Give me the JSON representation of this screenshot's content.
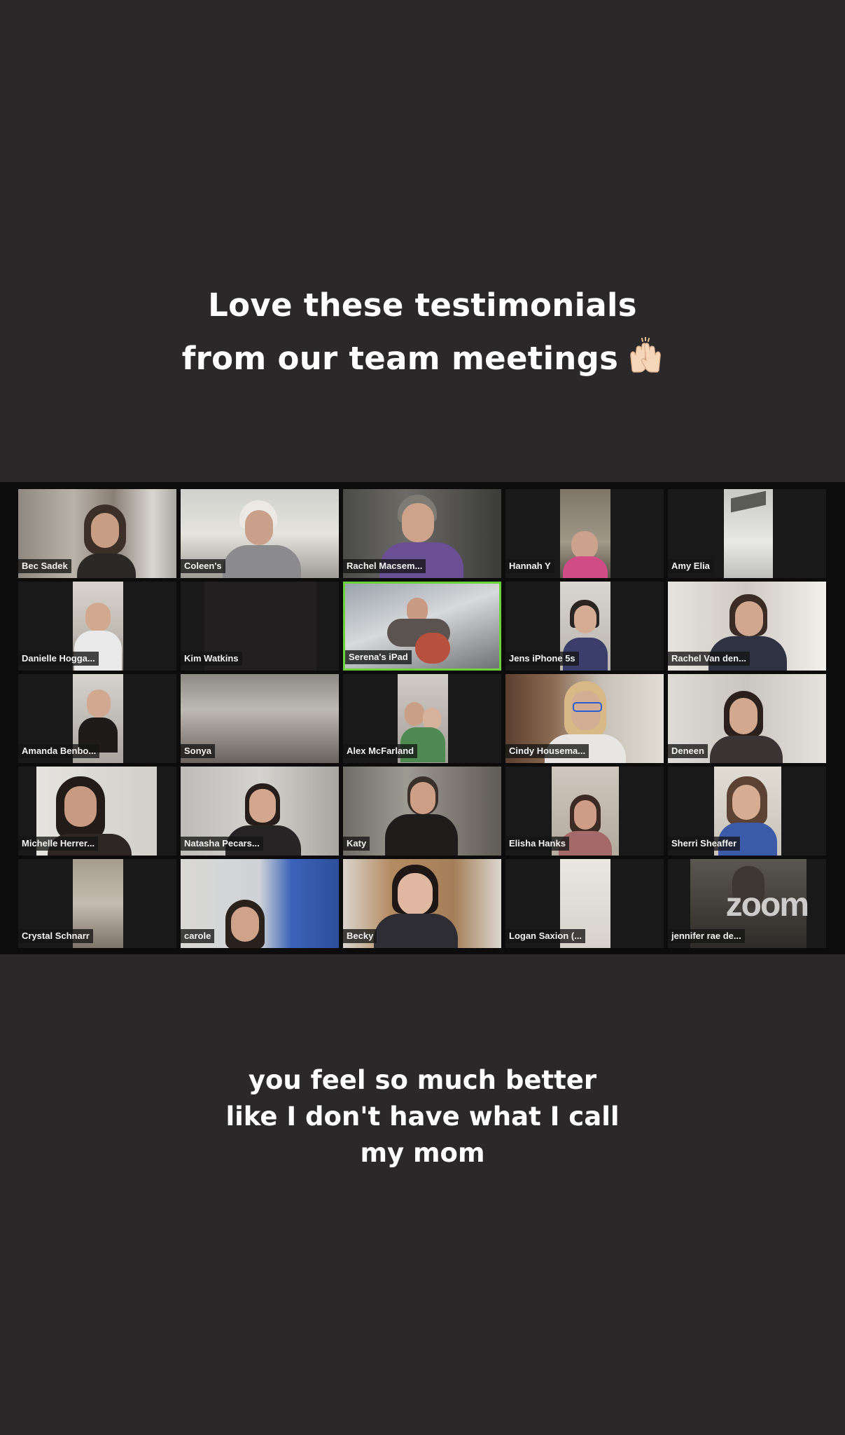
{
  "headline": {
    "line1": "Love these testimonials",
    "line2": "from our team meetings",
    "emoji": "raising-hands-icon"
  },
  "zoom": {
    "watermark": "zoom",
    "active_speaker_color": "#6ad43a",
    "participants": [
      {
        "name": "Bec Sadek"
      },
      {
        "name": "Coleen's"
      },
      {
        "name": "Rachel Macsem..."
      },
      {
        "name": "Hannah Y"
      },
      {
        "name": "Amy Elia"
      },
      {
        "name": "Danielle Hogga..."
      },
      {
        "name": "Kim Watkins"
      },
      {
        "name": "Serena's iPad",
        "active": true
      },
      {
        "name": "Jens iPhone 5s"
      },
      {
        "name": "Rachel Van den..."
      },
      {
        "name": "Amanda Benbo..."
      },
      {
        "name": "Sonya"
      },
      {
        "name": "Alex McFarland"
      },
      {
        "name": "Cindy Housema..."
      },
      {
        "name": "Deneen"
      },
      {
        "name": "Michelle Herrer..."
      },
      {
        "name": "Natasha Pecars..."
      },
      {
        "name": "Katy"
      },
      {
        "name": "Elisha Hanks"
      },
      {
        "name": "Sherri Sheaffer"
      },
      {
        "name": "Crystal Schnarr"
      },
      {
        "name": "carole"
      },
      {
        "name": "Becky"
      },
      {
        "name": "Logan Saxion (..."
      },
      {
        "name": "jennifer rae de..."
      }
    ]
  },
  "caption": {
    "line1": "you feel so much better",
    "line2": "like I don't have what I call",
    "line3": "my mom"
  }
}
